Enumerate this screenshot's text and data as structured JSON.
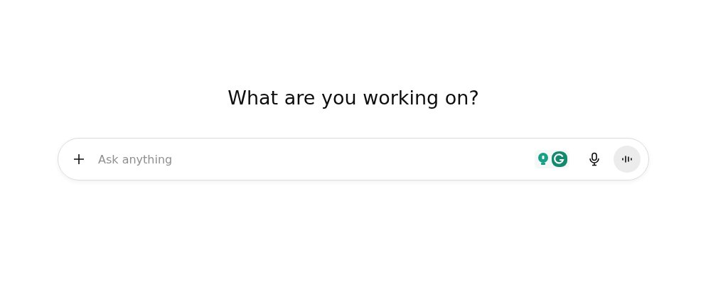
{
  "heading": "What are you working on?",
  "composer": {
    "placeholder": "Ask anything"
  }
}
